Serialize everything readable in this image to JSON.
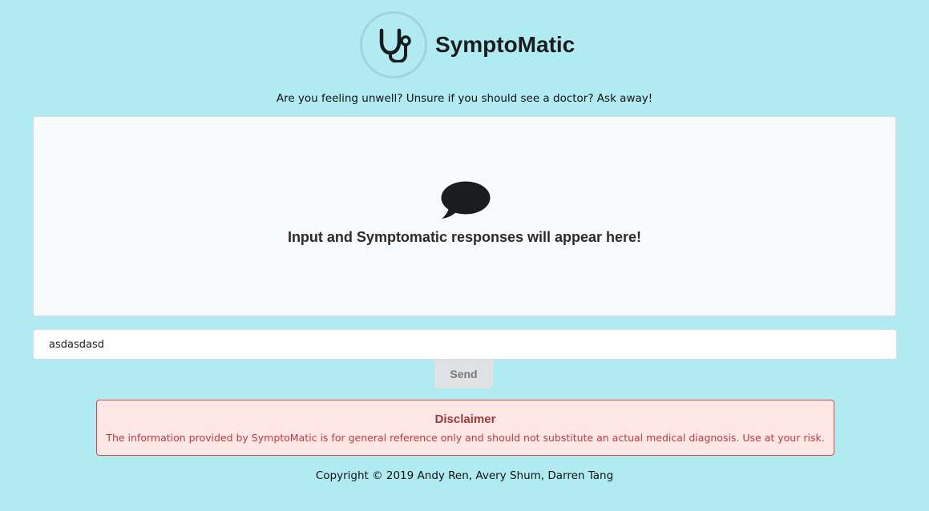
{
  "header": {
    "title": "SymptoMatic",
    "logo_icon": "stethoscope-icon"
  },
  "tagline": "Are you feeling unwell? Unsure if you should see a doctor? Ask away!",
  "chat": {
    "icon": "speech-bubble-icon",
    "placeholder": "Input and Symptomatic responses will appear here!"
  },
  "input": {
    "value": "asdasdasd"
  },
  "send_label": "Send",
  "disclaimer": {
    "title": "Disclaimer",
    "body": "The information provided by SymptoMatic is for general reference only and should not substitute an actual medical diagnosis. Use at your risk."
  },
  "footer": {
    "copyright": "Copyright © 2019 Andy Ren, Avery Shum, Darren Tang"
  },
  "colors": {
    "background": "#b0ebf1",
    "panel": "#f8f9fb",
    "disclaimer_bg": "#ffe7e6",
    "disclaimer_border": "#d5484a",
    "disclaimer_title": "#9f3a38",
    "disclaimer_text": "#c0393f"
  }
}
